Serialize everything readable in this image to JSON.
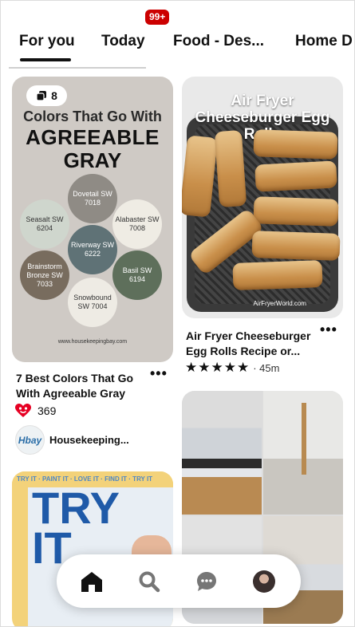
{
  "tabs": [
    "For you",
    "Today",
    "Food - Des...",
    "Home D"
  ],
  "pins": {
    "agreeable_gray": {
      "board_count": "8",
      "heading_line1": "Colors That Go With",
      "heading_line2": "AGREEABLE",
      "heading_line3": "GRAY",
      "swatches": [
        {
          "name": "Dovetail SW 7018",
          "color": "#8f8b85"
        },
        {
          "name": "Seasalt SW 6204",
          "color": "#cfd6cd"
        },
        {
          "name": "Alabaster SW 7008",
          "color": "#efece4"
        },
        {
          "name": "Riverway SW 6222",
          "color": "#5f7276"
        },
        {
          "name": "Brainstorm Bronze SW 7033",
          "color": "#786c5e"
        },
        {
          "name": "Basil SW 6194",
          "color": "#5e6f5b"
        },
        {
          "name": "Snowbound SW 7004",
          "color": "#eeebe4"
        }
      ],
      "site": "www.housekeepingbay.com",
      "title": "7 Best Colors That Go With Agreeable Gray",
      "reactions": "369",
      "author": "Housekeeping...",
      "author_initials": "Hbay"
    },
    "egg_rolls": {
      "image_title": "Air Fryer Cheeseburger Egg Rolls",
      "watermark": "AirFryerWorld.com",
      "title": "Air Fryer Cheeseburger Egg Rolls Recipe or...",
      "stars": "★★★★★",
      "duration": "· 45m"
    },
    "try_it": {
      "banner": "TRY IT · PAINT IT · LOVE IT · FIND IT · TRY IT",
      "big_text_line1": "TRY",
      "big_text_line2": "IT"
    }
  },
  "more_icon": "•••",
  "notifications_badge": "99+",
  "colors": {
    "badge_red": "#cc0000",
    "heart_red": "#e60023"
  }
}
